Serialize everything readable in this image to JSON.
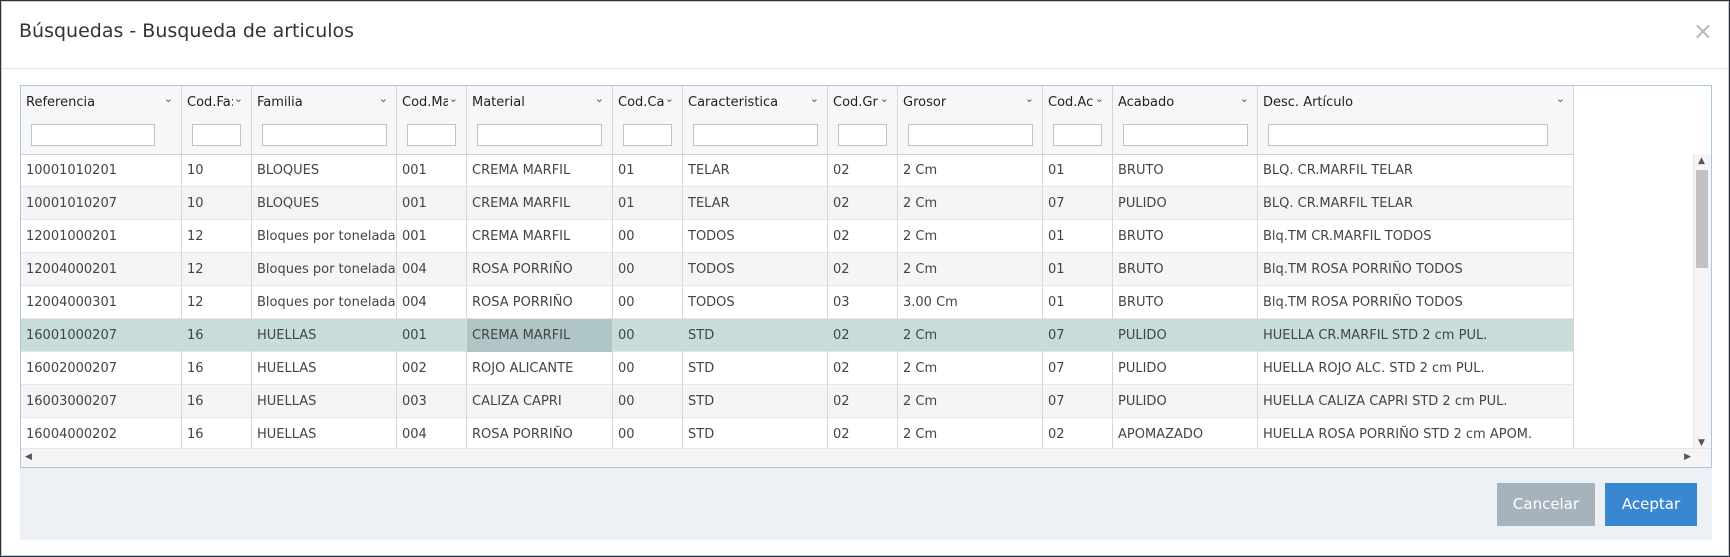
{
  "dialog": {
    "title": "Búsquedas - Busqueda de articulos",
    "close_glyph": "×"
  },
  "grid": {
    "columns": [
      {
        "name": "col-referencia",
        "label": "Referencia"
      },
      {
        "name": "col-cod-familia",
        "label": "Cod.Fa:"
      },
      {
        "name": "col-familia",
        "label": "Familia"
      },
      {
        "name": "col-cod-material",
        "label": "Cod.Ma:"
      },
      {
        "name": "col-material",
        "label": "Material"
      },
      {
        "name": "col-cod-caracteristica",
        "label": "Cod.Car:"
      },
      {
        "name": "col-caracteristica",
        "label": "Caracteristica"
      },
      {
        "name": "col-cod-grosor",
        "label": "Cod.Gr:"
      },
      {
        "name": "col-grosor",
        "label": "Grosor"
      },
      {
        "name": "col-cod-acabado",
        "label": "Cod.Ac:"
      },
      {
        "name": "col-acabado",
        "label": "Acabado"
      },
      {
        "name": "col-desc-articulo",
        "label": "Desc. Artículo"
      }
    ],
    "filters": [
      "",
      "",
      "",
      "",
      "",
      "",
      "",
      "",
      "",
      "",
      "",
      ""
    ],
    "rows": [
      [
        "10001010201",
        "10",
        "BLOQUES",
        "001",
        "CREMA MARFIL",
        "01",
        "TELAR",
        "02",
        "2 Cm",
        "01",
        "BRUTO",
        "BLQ. CR.MARFIL TELAR"
      ],
      [
        "10001010207",
        "10",
        "BLOQUES",
        "001",
        "CREMA MARFIL",
        "01",
        "TELAR",
        "02",
        "2 Cm",
        "07",
        "PULIDO",
        "BLQ. CR.MARFIL TELAR"
      ],
      [
        "12001000201",
        "12",
        "Bloques por tonelada",
        "001",
        "CREMA MARFIL",
        "00",
        "TODOS",
        "02",
        "2 Cm",
        "01",
        "BRUTO",
        "Blq.TM CR.MARFIL TODOS"
      ],
      [
        "12004000201",
        "12",
        "Bloques por tonelada",
        "004",
        "ROSA PORRIÑO",
        "00",
        "TODOS",
        "02",
        "2 Cm",
        "01",
        "BRUTO",
        "Blq.TM ROSA PORRIÑO TODOS"
      ],
      [
        "12004000301",
        "12",
        "Bloques por tonelada",
        "004",
        "ROSA PORRIÑO",
        "00",
        "TODOS",
        "03",
        "3.00 Cm",
        "01",
        "BRUTO",
        "Blq.TM ROSA PORRIÑO TODOS"
      ],
      [
        "16001000207",
        "16",
        "HUELLAS",
        "001",
        "CREMA MARFIL",
        "00",
        "STD",
        "02",
        "2 Cm",
        "07",
        "PULIDO",
        "HUELLA CR.MARFIL STD 2 cm PUL."
      ],
      [
        "16002000207",
        "16",
        "HUELLAS",
        "002",
        "ROJO ALICANTE",
        "00",
        "STD",
        "02",
        "2 Cm",
        "07",
        "PULIDO",
        "HUELLA ROJO ALC. STD 2 cm PUL."
      ],
      [
        "16003000207",
        "16",
        "HUELLAS",
        "003",
        "CALIZA CAPRI",
        "00",
        "STD",
        "02",
        "2 Cm",
        "07",
        "PULIDO",
        "HUELLA CALIZA CAPRI STD 2 cm PUL."
      ],
      [
        "16004000202",
        "16",
        "HUELLAS",
        "004",
        "ROSA PORRIÑO",
        "00",
        "STD",
        "02",
        "2 Cm",
        "02",
        "APOMAZADO",
        "HUELLA ROSA PORRIÑO STD 2 cm APOM."
      ]
    ],
    "selected_row": 5,
    "focused_cell": 4,
    "chevron_glyph": "⌄",
    "scroll_up_glyph": "▲",
    "scroll_down_glyph": "▼",
    "scroll_left_glyph": "◀",
    "scroll_right_glyph": "▶"
  },
  "footer": {
    "cancel_label": "Cancelar",
    "accept_label": "Aceptar"
  },
  "colors": {
    "accept": "#3a87d1",
    "cancel": "#a6b2bc",
    "selected_row": "#c8dcdc",
    "focused_cell": "#b0c5c6",
    "grid_border": "#a9c7e4",
    "footer_bg": "#edf1f6"
  }
}
